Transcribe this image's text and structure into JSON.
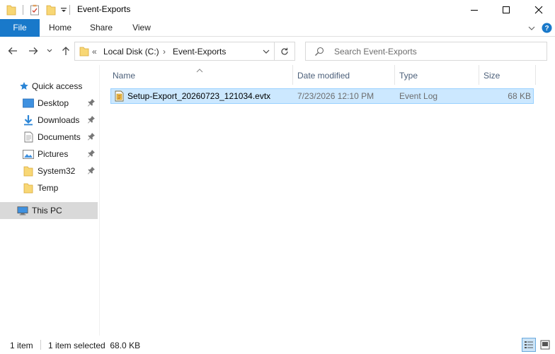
{
  "window": {
    "title": "Event-Exports",
    "icons": {
      "folder": "folder-icon",
      "properties": "properties-icon",
      "new_folder": "new-folder-icon",
      "customize": "qat-dropdown-icon"
    },
    "controls": {
      "minimize": "minimize-icon",
      "maximize": "maximize-icon",
      "close": "close-icon"
    }
  },
  "ribbon": {
    "tabs": [
      "File",
      "Home",
      "Share",
      "View"
    ],
    "accent": "#1979ca",
    "expand_icon": "chevron-down-icon",
    "help_icon": "help-icon"
  },
  "address_bar": {
    "overflow": "«",
    "crumbs": [
      "Local Disk (C:)",
      "Event-Exports"
    ],
    "separator": "›"
  },
  "search": {
    "placeholder": "Search Event-Exports"
  },
  "nav_pane": {
    "items": [
      {
        "label": "Quick access",
        "icon": "star-icon",
        "pinned": false,
        "selected": false
      },
      {
        "label": "Desktop",
        "icon": "desktop-icon",
        "pinned": true,
        "selected": false
      },
      {
        "label": "Downloads",
        "icon": "download-icon",
        "pinned": true,
        "selected": false
      },
      {
        "label": "Documents",
        "icon": "documents-icon",
        "pinned": true,
        "selected": false
      },
      {
        "label": "Pictures",
        "icon": "pictures-icon",
        "pinned": true,
        "selected": false
      },
      {
        "label": "System32",
        "icon": "folder-icon",
        "pinned": true,
        "selected": false
      },
      {
        "label": "Temp",
        "icon": "folder-icon",
        "pinned": false,
        "selected": false
      },
      {
        "label": "This PC",
        "icon": "computer-icon",
        "pinned": false,
        "selected": true
      }
    ]
  },
  "file_list": {
    "columns": [
      "Name",
      "Date modified",
      "Type",
      "Size"
    ],
    "rows": [
      {
        "name": "Setup-Export_20260723_121034.evtx",
        "date": "7/23/2026 12:10 PM",
        "type": "Event Log",
        "size": "68 KB",
        "icon": "event-log-icon",
        "selected": true
      }
    ]
  },
  "status": {
    "item_count": "1 item",
    "selection": "1 item selected  68.0 KB",
    "views": [
      "details-view-icon",
      "large-icons-view-icon"
    ]
  }
}
